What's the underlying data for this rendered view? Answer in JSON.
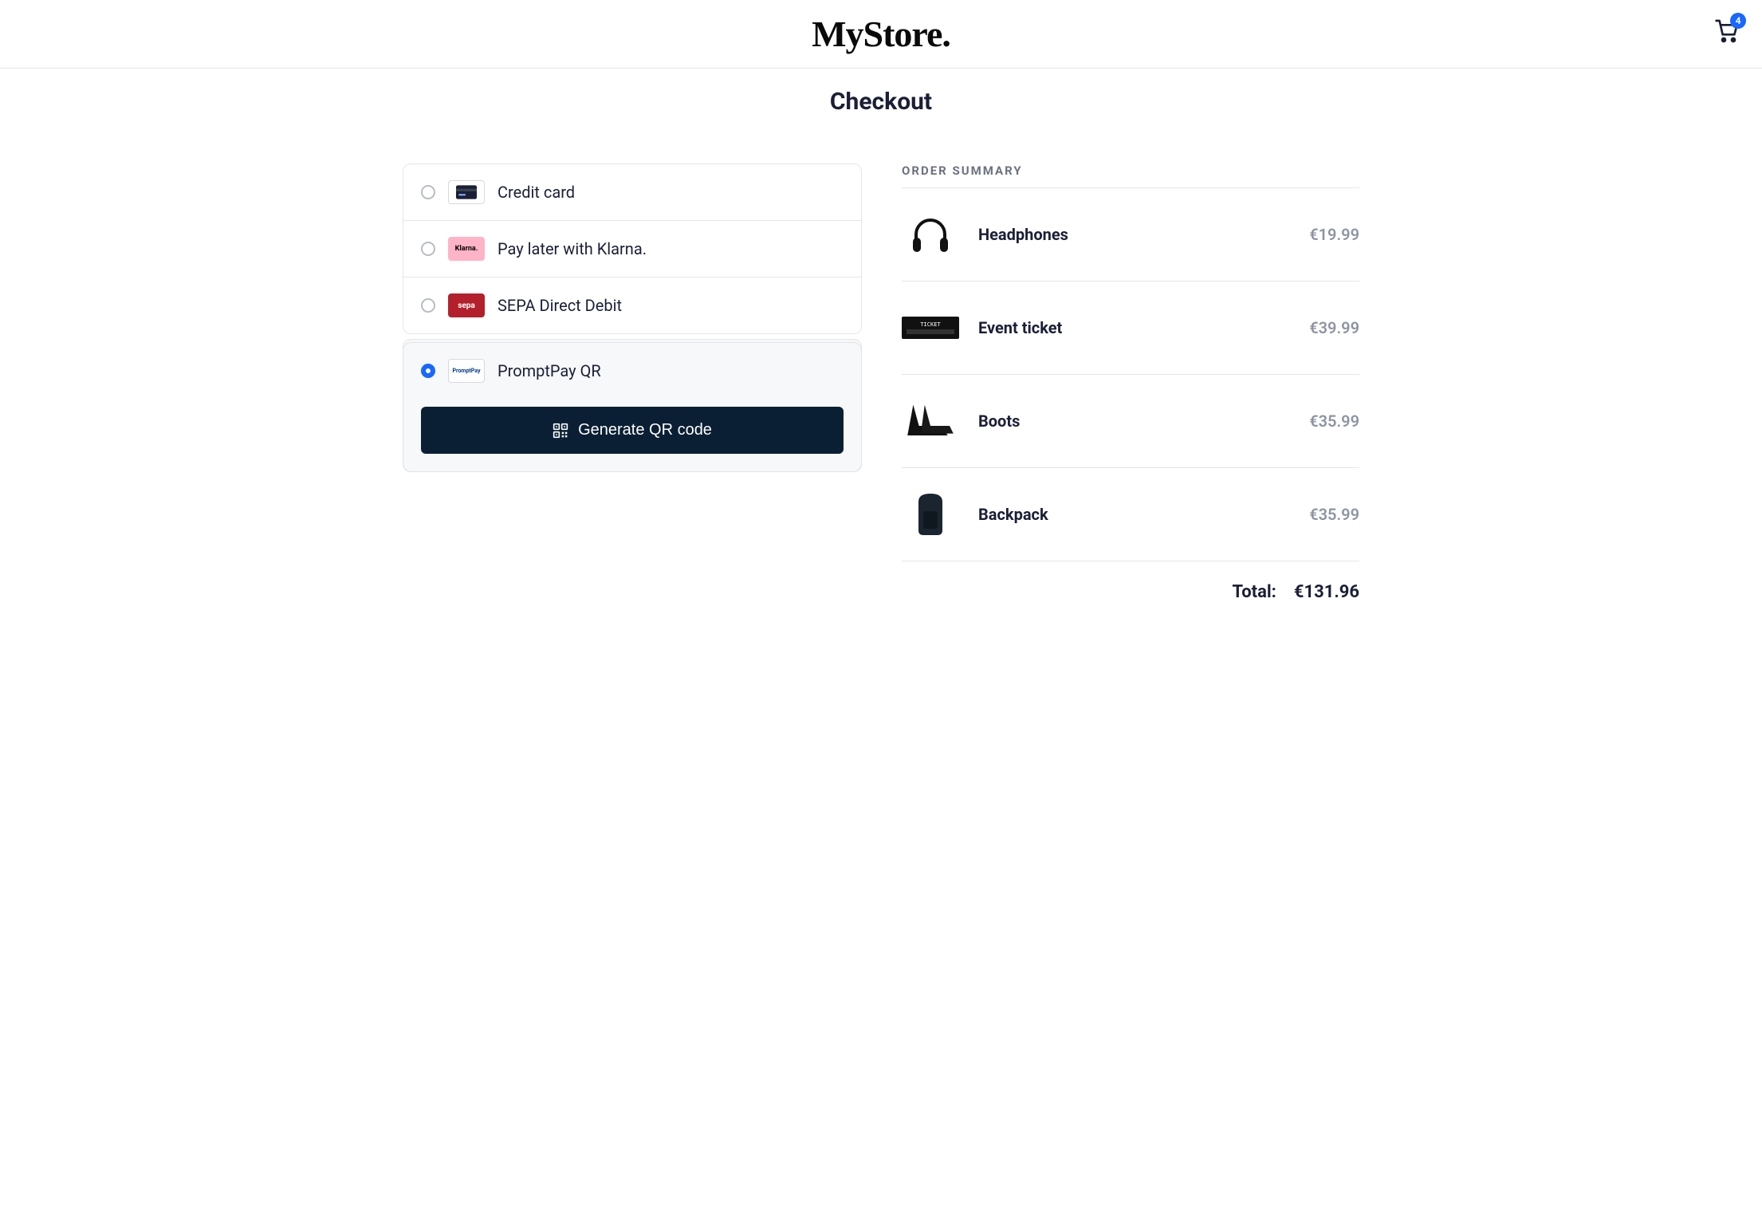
{
  "header": {
    "store_name": "MyStore.",
    "cart_count": "4"
  },
  "page": {
    "title": "Checkout"
  },
  "payment_methods": {
    "credit_card": {
      "label": "Credit card",
      "selected": false
    },
    "klarna": {
      "label": "Pay later with Klarna.",
      "selected": false,
      "badge": "Klarna."
    },
    "sepa": {
      "label": "SEPA Direct Debit",
      "selected": false,
      "badge": "sepa"
    },
    "promptpay": {
      "label": "PromptPay QR",
      "selected": true,
      "badge": "PromptPay",
      "button": "Generate QR code"
    }
  },
  "order_summary": {
    "title": "ORDER SUMMARY",
    "items": [
      {
        "name": "Headphones",
        "price": "€19.99"
      },
      {
        "name": "Event ticket",
        "price": "€39.99"
      },
      {
        "name": "Boots",
        "price": "€35.99"
      },
      {
        "name": "Backpack",
        "price": "€35.99"
      }
    ],
    "total_label": "Total:",
    "total_value": "€131.96"
  }
}
